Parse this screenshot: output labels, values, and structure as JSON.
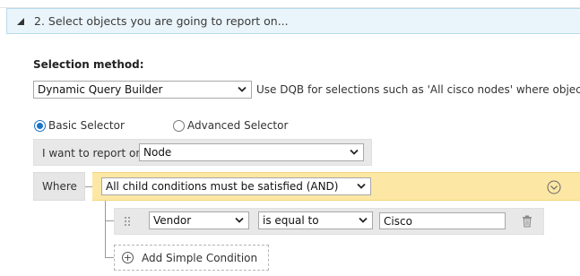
{
  "section": {
    "title": "2. Select objects you are going to report on..."
  },
  "selection_method": {
    "label": "Selection method:",
    "value": "Dynamic Query Builder",
    "hint": "Use DQB for selections such as 'All cisco nodes' where objec"
  },
  "selectors": {
    "basic_label": "Basic Selector",
    "advanced_label": "Advanced Selector",
    "selected": "basic"
  },
  "report_on": {
    "label": "I want to report on",
    "value": "Node"
  },
  "where": {
    "label": "Where",
    "group_value": "All child conditions must be satisfied (AND)"
  },
  "condition": {
    "field": "Vendor",
    "operator": "is equal to",
    "value": "Cisco"
  },
  "add_condition": {
    "label": "Add Simple Condition"
  },
  "colors": {
    "header_bg": "#eaf5fb",
    "and_band": "#fde7a4",
    "radio_accent": "#1a73c7"
  },
  "icons": {
    "collapse": "triangle-down-left-icon",
    "expand": "chevron-circle-down-icon",
    "drag": "drag-handle-icon",
    "delete": "trash-icon",
    "add": "plus-circle-icon"
  }
}
